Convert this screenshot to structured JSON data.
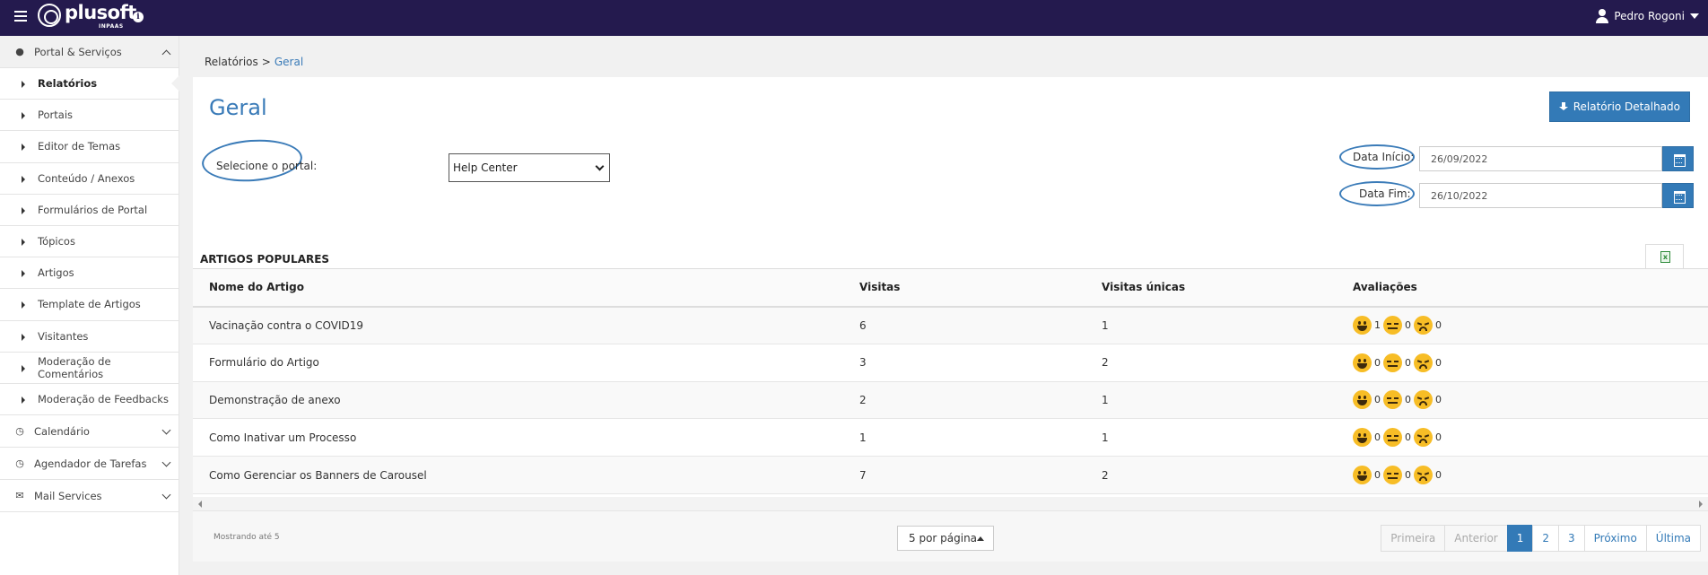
{
  "header": {
    "brand": "plusoft",
    "brand_sub": "INPAAS",
    "user_name": "Pedro Rogoni"
  },
  "sidebar": {
    "groups": [
      {
        "label": "Portal & Serviços",
        "icon": "globe-icon",
        "open": true,
        "items": [
          {
            "label": "Relatórios",
            "active": true
          },
          {
            "label": "Portais"
          },
          {
            "label": "Editor de Temas"
          },
          {
            "label": "Conteúdo / Anexos"
          },
          {
            "label": "Formulários de Portal"
          },
          {
            "label": "Tópicos"
          },
          {
            "label": "Artigos"
          },
          {
            "label": "Template de Artigos"
          },
          {
            "label": "Visitantes"
          },
          {
            "label": "Moderação de Comentários"
          },
          {
            "label": "Moderação de Feedbacks"
          }
        ]
      },
      {
        "label": "Calendário",
        "icon": "clock-icon"
      },
      {
        "label": "Agendador de Tarefas",
        "icon": "clock-icon"
      },
      {
        "label": "Mail Services",
        "icon": "envelope-icon"
      }
    ]
  },
  "breadcrumb": {
    "parent": "Relatórios",
    "separator": ">",
    "current": "Geral"
  },
  "page": {
    "title": "Geral",
    "detailed_report_button": "Relatório Detalhado",
    "portal_label": "Selecione o portal:",
    "portal_selected": "Help Center",
    "start_date_label": "Data Início:",
    "start_date": "26/09/2022",
    "end_date_label": "Data Fim:",
    "end_date": "26/10/2022"
  },
  "popular_articles": {
    "title": "ARTIGOS POPULARES",
    "columns": [
      "Nome do Artigo",
      "Visitas",
      "Visitas únicas",
      "Avaliações"
    ],
    "rows": [
      {
        "name": "Vacinação contra o COVID19",
        "visits": "6",
        "unique": "1",
        "happy": "1",
        "neutral": "0",
        "sad": "0"
      },
      {
        "name": "Formulário do Artigo",
        "visits": "3",
        "unique": "2",
        "happy": "0",
        "neutral": "0",
        "sad": "0"
      },
      {
        "name": "Demonstração de anexo",
        "visits": "2",
        "unique": "1",
        "happy": "0",
        "neutral": "0",
        "sad": "0"
      },
      {
        "name": "Como Inativar um Processo",
        "visits": "1",
        "unique": "1",
        "happy": "0",
        "neutral": "0",
        "sad": "0"
      },
      {
        "name": "Como Gerenciar os Banners de Carousel",
        "visits": "7",
        "unique": "2",
        "happy": "0",
        "neutral": "0",
        "sad": "0"
      }
    ],
    "showing": "Mostrando até 5",
    "per_page": "5 por página",
    "pagination": {
      "first": "Primeira",
      "prev": "Anterior",
      "pages": [
        "1",
        "2",
        "3"
      ],
      "current": "1",
      "next": "Próximo",
      "last": "Última"
    }
  },
  "colors": {
    "topbar": "#241a4e",
    "accent": "#337ab7",
    "title": "#3a7bb8"
  }
}
